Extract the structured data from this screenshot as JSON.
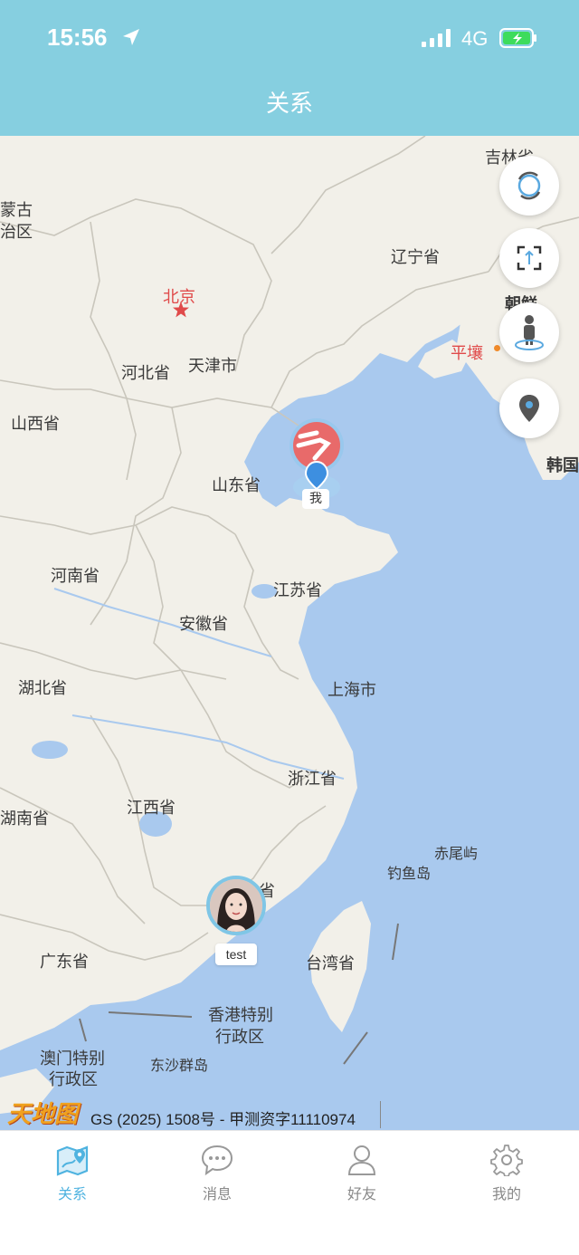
{
  "status_bar": {
    "time": "15:56",
    "network": "4G"
  },
  "header": {
    "title": "关系"
  },
  "map": {
    "labels": {
      "jilin": "吉林省",
      "neimenggu_1": "蒙古",
      "neimenggu_2": "治区",
      "liaoning": "辽宁省",
      "beijing": "北京",
      "chaoxian": "朝鲜",
      "pingrang": "平壤",
      "hebei": "河北省",
      "tianjin": "天津市",
      "shanxi": "山西省",
      "shandong": "山东省",
      "hanguo": "韩国",
      "henan": "河南省",
      "jiangsu": "江苏省",
      "anhui": "安徽省",
      "hubei": "湖北省",
      "shanghai": "上海市",
      "zhejiang": "浙江省",
      "jiangxi": "江西省",
      "hunan": "湖南省",
      "chiweiyu": "赤尾屿",
      "diaoyudao": "钓鱼岛",
      "fujian": "省",
      "guangdong": "广东省",
      "taiwan": "台湾省",
      "hongkong_1": "香港特别",
      "hongkong_2": "行政区",
      "macau_1": "澳门特别",
      "macau_2": "行政区",
      "dongsha": "东沙群岛"
    },
    "markers": {
      "me_label": "我",
      "friend_label": "test"
    },
    "logo_text": "天地图",
    "copyright": "GS (2025) 1508号 - 甲测资字11110974",
    "controls": [
      "refresh-icon",
      "fullscreen-icon",
      "street-view-icon",
      "location-pin-icon"
    ]
  },
  "tabs": [
    {
      "label": "关系",
      "icon": "map-icon",
      "active": true
    },
    {
      "label": "消息",
      "icon": "chat-bubble-icon",
      "active": false
    },
    {
      "label": "好友",
      "icon": "person-icon",
      "active": false
    },
    {
      "label": "我的",
      "icon": "gear-icon",
      "active": false
    }
  ],
  "colors": {
    "header_bg": "#86cfe0",
    "sea": "#a9c9ee",
    "land": "#f2f0e9",
    "tab_active": "#4fb3e0",
    "tab_inactive": "#888888"
  }
}
